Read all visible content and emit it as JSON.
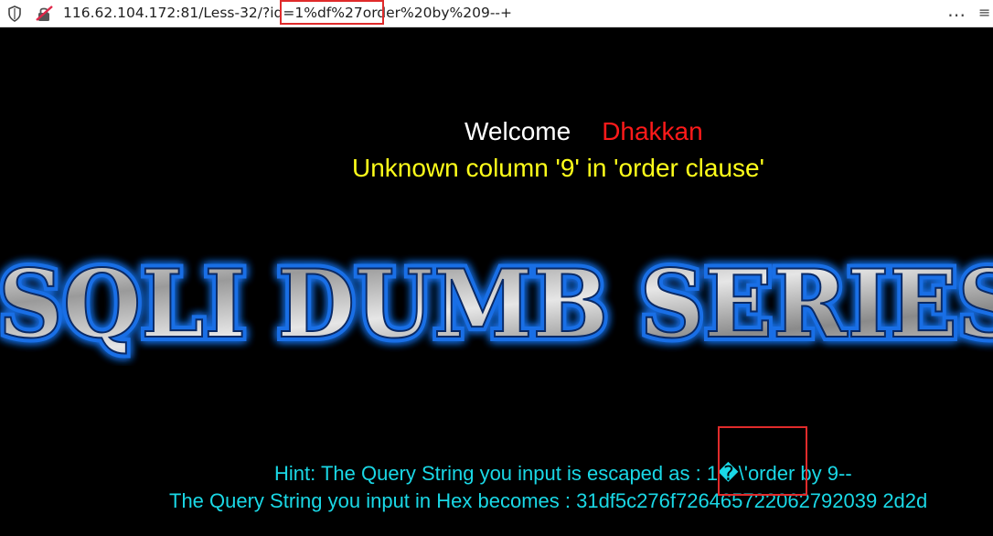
{
  "browser": {
    "url": "116.62.104.172:81/Less-32/?id=1%df%27order%20by%209--+"
  },
  "page": {
    "welcome_label": "Welcome",
    "user_name": "Dhakkan",
    "error_message": "Unknown column '9' in 'order clause'",
    "banner_text": "SQLI DUMB SERIES",
    "hint_text": "Hint: The Query String you input is escaped as : 1�\\'order by 9--",
    "hex_text": "The Query String you input in Hex becomes : 31df5c276f726465722062792039 2d2d"
  },
  "colors": {
    "background": "#000000",
    "welcome": "#ffffff",
    "user_name": "#ff1a1a",
    "error": "#ffff1a",
    "hint": "#1ad8e6",
    "highlight_box": "#e02b2b",
    "banner_glow": "#1e7bff"
  }
}
